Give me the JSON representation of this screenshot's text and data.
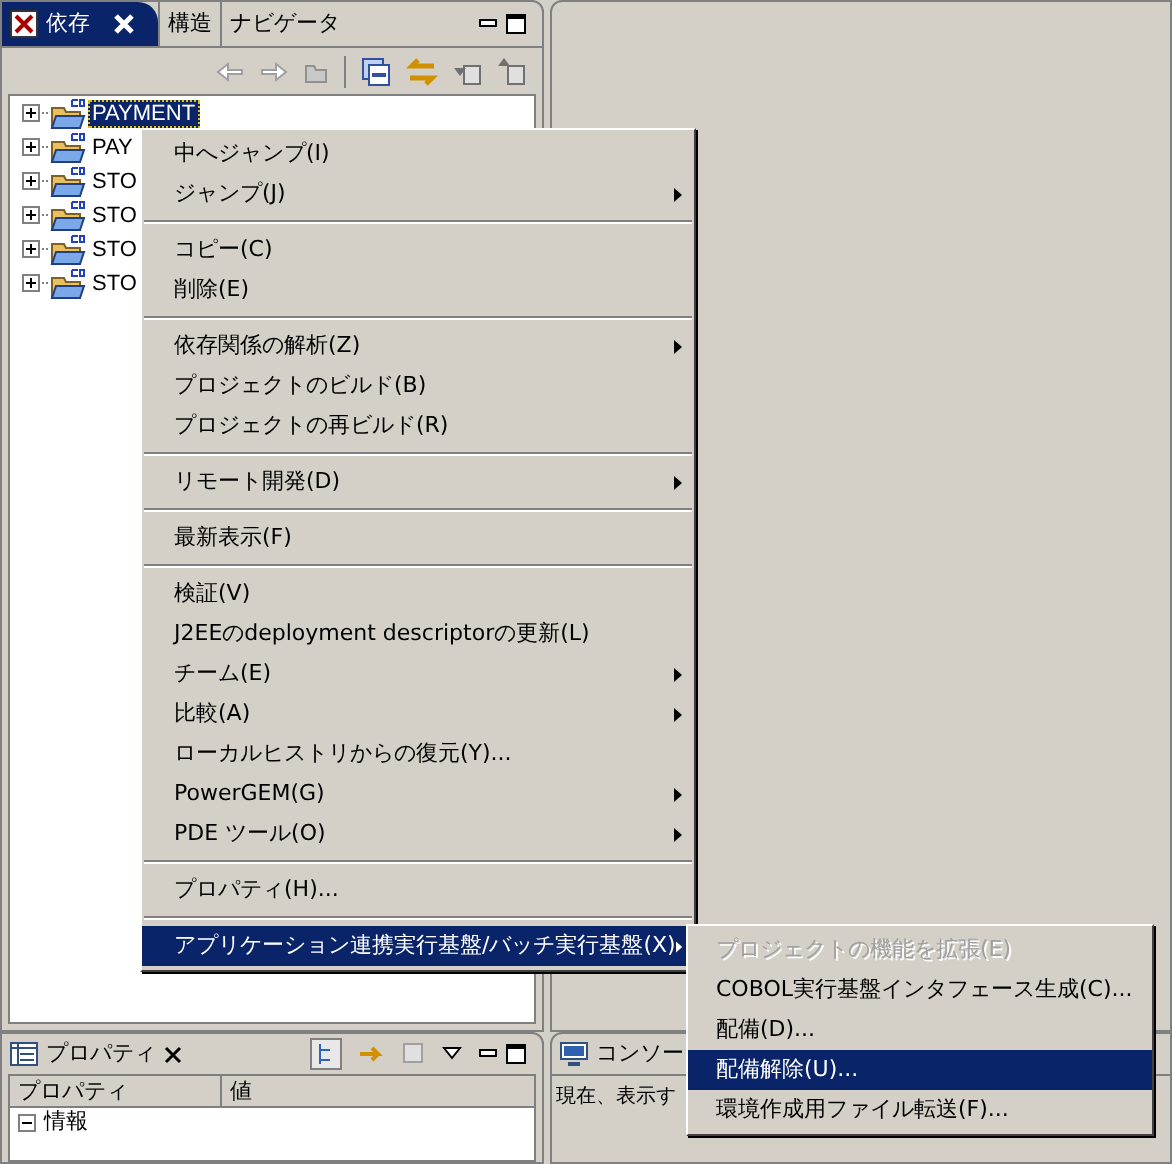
{
  "left_view": {
    "tabs": [
      {
        "label": "依存",
        "selected": true,
        "closable": true
      },
      {
        "label": "構造",
        "selected": false,
        "closable": false
      },
      {
        "label": "ナビゲータ",
        "selected": false,
        "closable": false
      }
    ],
    "tree": [
      {
        "label": "PAYMENT",
        "selected": true
      },
      {
        "label": "PAY",
        "selected": false
      },
      {
        "label": "STO",
        "selected": false
      },
      {
        "label": "STO",
        "selected": false
      },
      {
        "label": "STO",
        "selected": false
      },
      {
        "label": "STO",
        "selected": false
      }
    ]
  },
  "context_menu": [
    {
      "kind": "item",
      "label": "中へジャンプ(I)",
      "submenu": false,
      "selected": false
    },
    {
      "kind": "item",
      "label": "ジャンプ(J)",
      "submenu": true,
      "selected": false
    },
    {
      "kind": "separator"
    },
    {
      "kind": "item",
      "label": "コピー(C)",
      "submenu": false,
      "selected": false
    },
    {
      "kind": "item",
      "label": "削除(E)",
      "submenu": false,
      "selected": false
    },
    {
      "kind": "separator"
    },
    {
      "kind": "item",
      "label": "依存関係の解析(Z)",
      "submenu": true,
      "selected": false
    },
    {
      "kind": "item",
      "label": "プロジェクトのビルド(B)",
      "submenu": false,
      "selected": false
    },
    {
      "kind": "item",
      "label": "プロジェクトの再ビルド(R)",
      "submenu": false,
      "selected": false
    },
    {
      "kind": "separator"
    },
    {
      "kind": "item",
      "label": "リモート開発(D)",
      "submenu": true,
      "selected": false
    },
    {
      "kind": "separator"
    },
    {
      "kind": "item",
      "label": "最新表示(F)",
      "submenu": false,
      "selected": false
    },
    {
      "kind": "separator"
    },
    {
      "kind": "item",
      "label": "検証(V)",
      "submenu": false,
      "selected": false
    },
    {
      "kind": "item",
      "label": "J2EEのdeployment descriptorの更新(L)",
      "submenu": false,
      "selected": false
    },
    {
      "kind": "item",
      "label": "チーム(E)",
      "submenu": true,
      "selected": false
    },
    {
      "kind": "item",
      "label": "比較(A)",
      "submenu": true,
      "selected": false
    },
    {
      "kind": "item",
      "label": "ローカルヒストリからの復元(Y)...",
      "submenu": false,
      "selected": false
    },
    {
      "kind": "item",
      "label": "PowerGEM(G)",
      "submenu": true,
      "selected": false
    },
    {
      "kind": "item",
      "label": "PDE ツール(O)",
      "submenu": true,
      "selected": false
    },
    {
      "kind": "separator"
    },
    {
      "kind": "item",
      "label": "プロパティ(H)...",
      "submenu": false,
      "selected": false
    },
    {
      "kind": "separator"
    },
    {
      "kind": "item",
      "label": "アプリケーション連携実行基盤/バッチ実行基盤(X)",
      "submenu": true,
      "selected": true
    }
  ],
  "submenu": [
    {
      "label": "プロジェクトの機能を拡張(E)",
      "disabled": true,
      "selected": false
    },
    {
      "label": "COBOL実行基盤インタフェース生成(C)...",
      "disabled": false,
      "selected": false
    },
    {
      "label": "配備(D)...",
      "disabled": false,
      "selected": false
    },
    {
      "label": "配備解除(U)...",
      "disabled": false,
      "selected": true
    },
    {
      "label": "環境作成用ファイル転送(F)...",
      "disabled": false,
      "selected": false
    }
  ],
  "properties_view": {
    "tab": "プロパティ",
    "columns": [
      "プロパティ",
      "値"
    ],
    "rows": [
      {
        "label": "情報",
        "expanded": true
      }
    ]
  },
  "console_view": {
    "tab": "コンソー",
    "message": "現在、表示す"
  }
}
